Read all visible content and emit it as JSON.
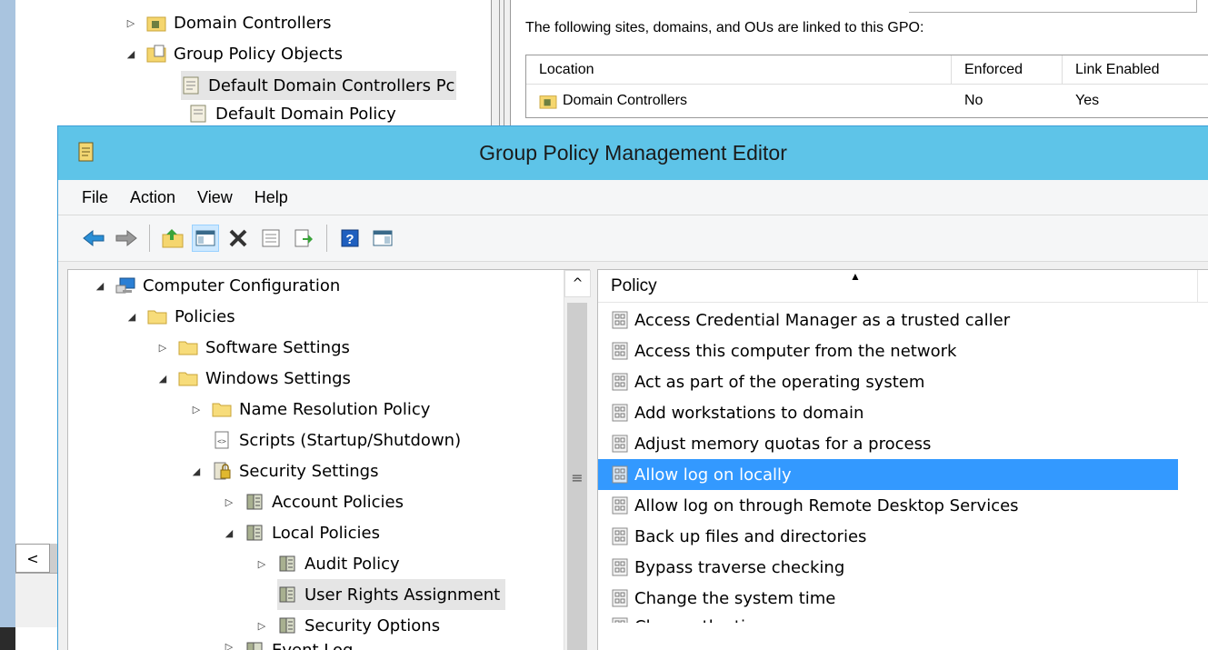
{
  "background": {
    "tree": [
      {
        "label": "Domain Controllers",
        "twisty": "▷"
      },
      {
        "label": "Group Policy Objects",
        "twisty": "◢"
      },
      {
        "label": "Default Domain Controllers Pc",
        "twisty": ""
      },
      {
        "label": "Default Domain Policy",
        "twisty": ""
      }
    ],
    "linked_text": "The following sites, domains, and OUs are linked to this GPO:",
    "link_table": {
      "headers": [
        "Location",
        "Enforced",
        "Link Enabled"
      ],
      "rows": [
        {
          "location": "Domain Controllers",
          "enforced": "No",
          "link_enabled": "Yes"
        }
      ]
    },
    "scroll_left": "<"
  },
  "editor": {
    "title": "Group Policy Management Editor",
    "menu": [
      "File",
      "Action",
      "View",
      "Help"
    ],
    "toolbar": {
      "buttons": [
        "back-icon",
        "forward-icon",
        "up-folder-icon",
        "show-hide-tree-icon",
        "delete-icon",
        "properties-icon",
        "export-list-icon",
        "help-icon",
        "show-pane-icon"
      ]
    },
    "tree": [
      {
        "label": "Computer Configuration",
        "twisty": "◢",
        "icon": "computer-icon"
      },
      {
        "label": "Policies",
        "twisty": "◢",
        "icon": "folder-icon"
      },
      {
        "label": "Software Settings",
        "twisty": "▷",
        "icon": "folder-icon"
      },
      {
        "label": "Windows Settings",
        "twisty": "◢",
        "icon": "folder-icon"
      },
      {
        "label": "Name Resolution Policy",
        "twisty": "▷",
        "icon": "folder-icon"
      },
      {
        "label": "Scripts (Startup/Shutdown)",
        "twisty": "",
        "icon": "script-icon"
      },
      {
        "label": "Security Settings",
        "twisty": "◢",
        "icon": "security-icon"
      },
      {
        "label": "Account Policies",
        "twisty": "▷",
        "icon": "policy-book-icon"
      },
      {
        "label": "Local Policies",
        "twisty": "◢",
        "icon": "policy-book-icon"
      },
      {
        "label": "Audit Policy",
        "twisty": "▷",
        "icon": "policy-book-icon"
      },
      {
        "label": "User Rights Assignment",
        "twisty": "",
        "icon": "policy-book-icon"
      },
      {
        "label": "Security Options",
        "twisty": "▷",
        "icon": "policy-book-icon"
      },
      {
        "label": "Event Log",
        "twisty": "▷",
        "icon": "policy-book-icon"
      }
    ],
    "tree_scroll": {
      "up": "^",
      "grip": "≡"
    },
    "list": {
      "column": "Policy",
      "sort_indicator": "▲",
      "selected_index": 5,
      "items": [
        "Access Credential Manager as a trusted caller",
        "Access this computer from the network",
        "Act as part of the operating system",
        "Add workstations to domain",
        "Adjust memory quotas for a process",
        "Allow log on locally",
        "Allow log on through Remote Desktop Services",
        "Back up files and directories",
        "Bypass traverse checking",
        "Change the system time",
        "Change the time zone"
      ]
    }
  },
  "colors": {
    "titlebar": "#5ec4e8",
    "selection": "#3399ff",
    "tree_selection": "#e5e5e5"
  }
}
